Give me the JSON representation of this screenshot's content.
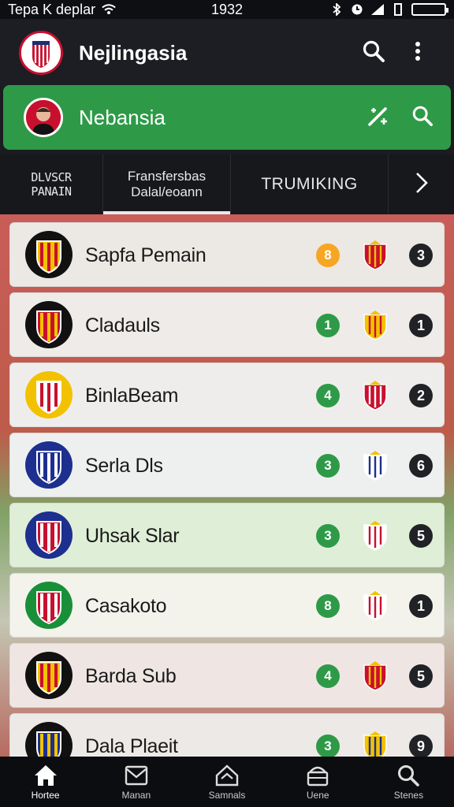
{
  "status_bar": {
    "carrier": "Tepa K deplar",
    "time": "1932"
  },
  "app_bar": {
    "title": "Nejlingasia"
  },
  "green_bar": {
    "title": "Nebansia"
  },
  "tabs": [
    {
      "line1": "DLVSCR",
      "line2": "PANAIN"
    },
    {
      "line1": "Fransfersbas",
      "line2": "Dalal/eoann",
      "active": true
    },
    {
      "line1": "TRUMIKING"
    }
  ],
  "colors": {
    "accent_green": "#2e9a48",
    "badge_orange": "#f5a623",
    "badge_green": "#2e9a48",
    "rank_dark": "#202226"
  },
  "teams": [
    {
      "name": "Sapfa Pemain",
      "badge": "8",
      "badge_color": "#f5a623",
      "rank": "3",
      "row_bg": "#ece8e3",
      "crest": "red-black"
    },
    {
      "name": "Cladauls",
      "badge": "1",
      "badge_color": "#2e9a48",
      "rank": "1",
      "row_bg": "#eeebe9",
      "crest": "yellow-red"
    },
    {
      "name": "BinlaBeam",
      "badge": "4",
      "badge_color": "#2e9a48",
      "rank": "2",
      "row_bg": "#efedec",
      "crest": "red-white"
    },
    {
      "name": "Serla Dls",
      "badge": "3",
      "badge_color": "#2e9a48",
      "rank": "6",
      "row_bg": "#eef0ef",
      "crest": "blue-white"
    },
    {
      "name": "Uhsak Slar",
      "badge": "3",
      "badge_color": "#2e9a48",
      "rank": "5",
      "row_bg": "#dfeed6",
      "crest": "red-blue"
    },
    {
      "name": "Casakoto",
      "badge": "8",
      "badge_color": "#2e9a48",
      "rank": "1",
      "row_bg": "#f3f3ec",
      "crest": "green-red"
    },
    {
      "name": "Barda Sub",
      "badge": "4",
      "badge_color": "#2e9a48",
      "rank": "5",
      "row_bg": "#efe6e4",
      "crest": "red-yellow"
    },
    {
      "name": "Dala Plaeit",
      "badge": "3",
      "badge_color": "#2e9a48",
      "rank": "9",
      "row_bg": "#ece9e7",
      "crest": "blue-yellow"
    }
  ],
  "bottom_nav": [
    {
      "label": "Hortee",
      "icon": "home-icon",
      "active": true
    },
    {
      "label": "Manan",
      "icon": "mail-icon"
    },
    {
      "label": "Samnals",
      "icon": "house-outline-icon"
    },
    {
      "label": "Uene",
      "icon": "store-icon"
    },
    {
      "label": "Stenes",
      "icon": "search-icon"
    }
  ]
}
